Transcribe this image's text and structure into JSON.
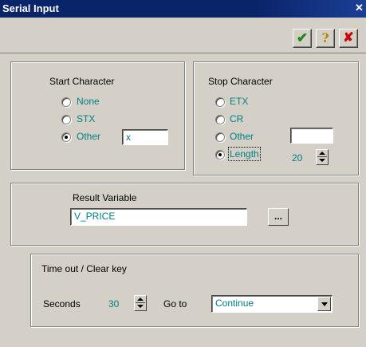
{
  "window": {
    "title": "Serial Input",
    "close_glyph": "✕"
  },
  "toolbar": {
    "ok_icon": "checkmark-icon",
    "help_icon": "question-mark-icon",
    "cancel_icon": "red-x-icon",
    "ok_glyph": "✔",
    "help_glyph": "?",
    "cancel_glyph": "✘",
    "ok_color": "#1a8a1a",
    "help_color": "#b08800",
    "cancel_color": "#cc0000"
  },
  "start_character": {
    "label": "Start Character",
    "options": [
      "None",
      "STX",
      "Other"
    ],
    "selected": "Other",
    "other_value": "x"
  },
  "stop_character": {
    "label": "Stop Character",
    "options": [
      "ETX",
      "CR",
      "Other",
      "Length"
    ],
    "selected": "Length",
    "other_value": "",
    "length_value": "20"
  },
  "result": {
    "label": "Result Variable",
    "value": "V_PRICE",
    "browse_label": "..."
  },
  "timeout": {
    "label": "Time out / Clear key",
    "seconds_label": "Seconds",
    "seconds_value": "30",
    "goto_label": "Go to",
    "goto_value": "Continue"
  },
  "colors": {
    "teal_text": "#008080",
    "titlebar": "#0a246a",
    "dialog_bg": "#d4d0c8"
  }
}
